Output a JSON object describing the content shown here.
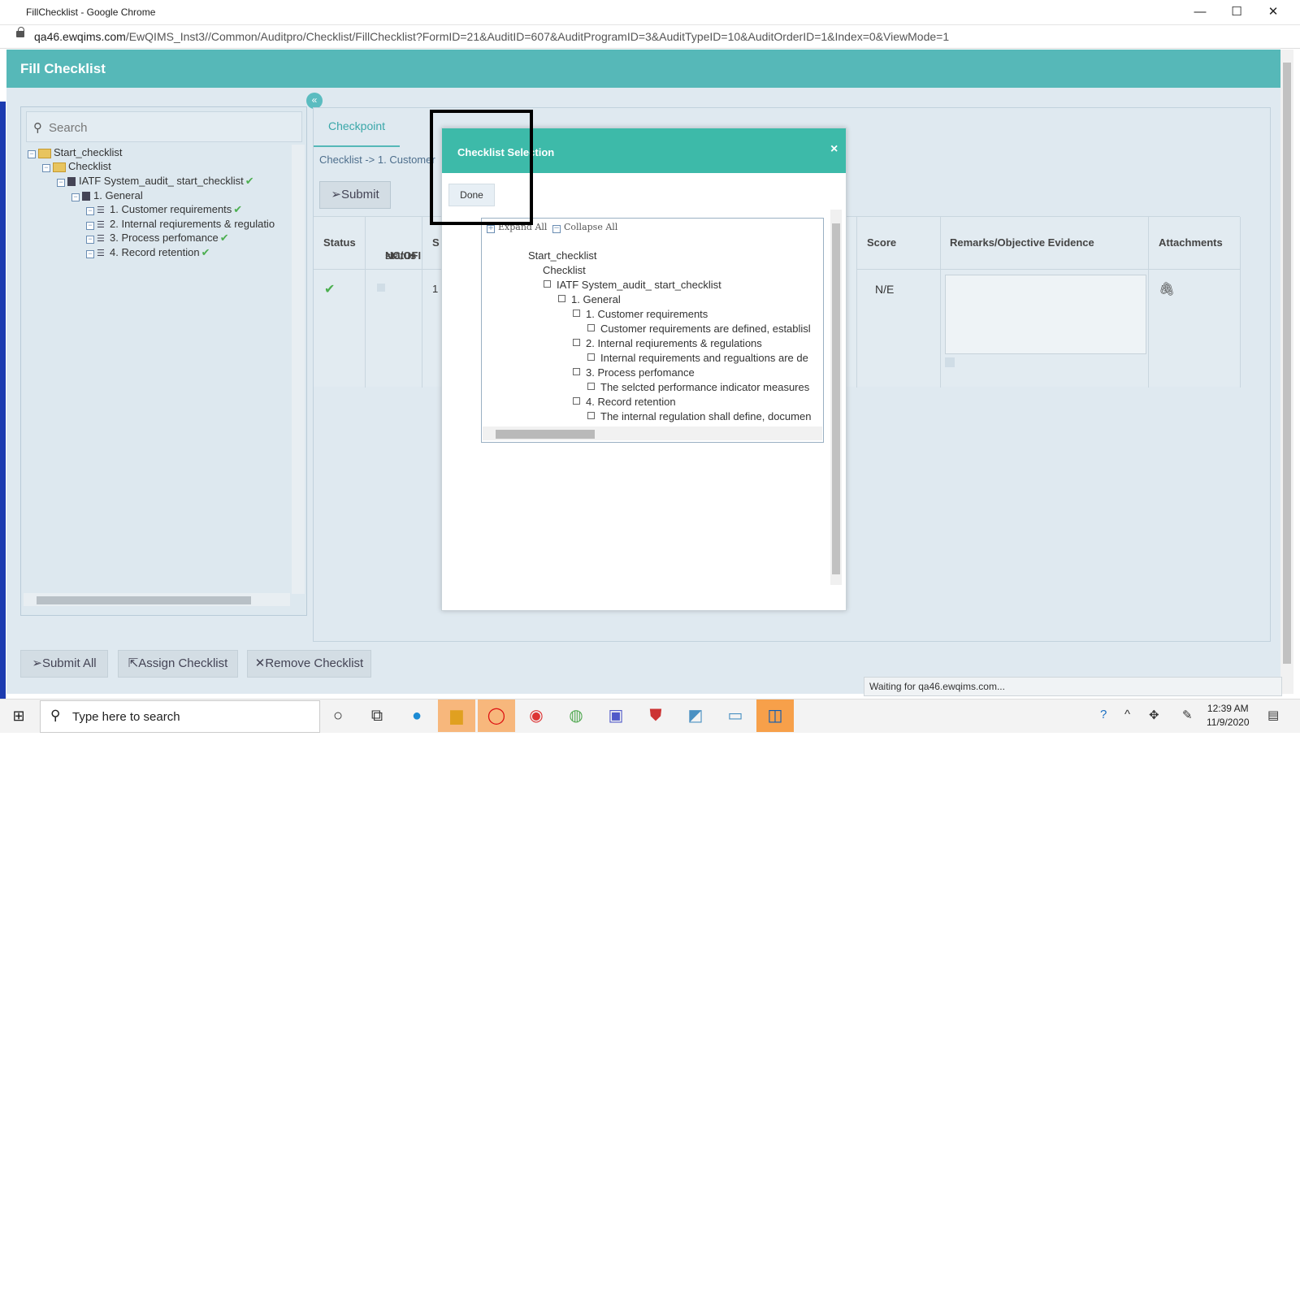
{
  "browser": {
    "window_title": "FillChecklist - Google Chrome",
    "minimize": "—",
    "maximize": "☐",
    "close": "✕",
    "url_host": "qa46.ewqims.com",
    "url_path": "/EwQIMS_Inst3//Common/Auditpro/Checklist/FillChecklist?FormID=21&AuditID=607&AuditProgramID=3&AuditTypeID=10&AuditOrderID=1&Index=0&ViewMode=1"
  },
  "header": {
    "title": "Fill Checklist"
  },
  "left_panel": {
    "search_placeholder": "Search",
    "tree": [
      {
        "label": "Start_checklist"
      },
      {
        "label": "Checklist"
      },
      {
        "label": "IATF System_audit_ start_checklist"
      },
      {
        "label": "1. General"
      },
      {
        "label": "1. Customer requirements"
      },
      {
        "label": "2. Internal reqiurements & regulatio"
      },
      {
        "label": "3. Process perfomance"
      },
      {
        "label": "4. Record retention"
      }
    ]
  },
  "main": {
    "tab_checkpoint": "Checkpoint",
    "breadcrumb": "Checklist -> 1. Customer",
    "submit_label": "Submit",
    "columns": {
      "status": "Status",
      "nc_ofi_1": "NC/OFI",
      "nc_ofi_2": "status",
      "s": "S",
      "score": "Score",
      "remarks": "Remarks/Objective Evidence",
      "attachments": "Attachments"
    },
    "row": {
      "s_value": "1",
      "score": "N/E"
    }
  },
  "bottom": {
    "submit_all": "Submit All",
    "assign_checklist": "Assign Checklist",
    "remove_checklist": "Remove Checklist",
    "status_text": "Waiting for qa46.ewqims.com..."
  },
  "modal": {
    "title": "Checklist Selection",
    "close": "×",
    "done_label": "Done",
    "expand_all": "Expand All",
    "collapse_all": "Collapse All",
    "tree": [
      "Start_checklist",
      "Checklist",
      "IATF System_audit_ start_checklist",
      "1. General",
      "1. Customer requirements",
      "Customer requirements are defined, establisl",
      "2. Internal reqiurements & regulations",
      "Internal requirements and regualtions are de",
      "3. Process perfomance",
      "The selcted performance indicator measures",
      "4. Record retention",
      "The internal regulation shall define, documen"
    ]
  },
  "taskbar": {
    "search_placeholder": "Type here to search",
    "time": "12:39 AM",
    "date": "11/9/2020"
  },
  "colors": {
    "header_teal": "#56b8b8",
    "modal_header": "#3dbaa9",
    "panel_bg": "#dfe9f0",
    "check_green": "#4caf50"
  }
}
